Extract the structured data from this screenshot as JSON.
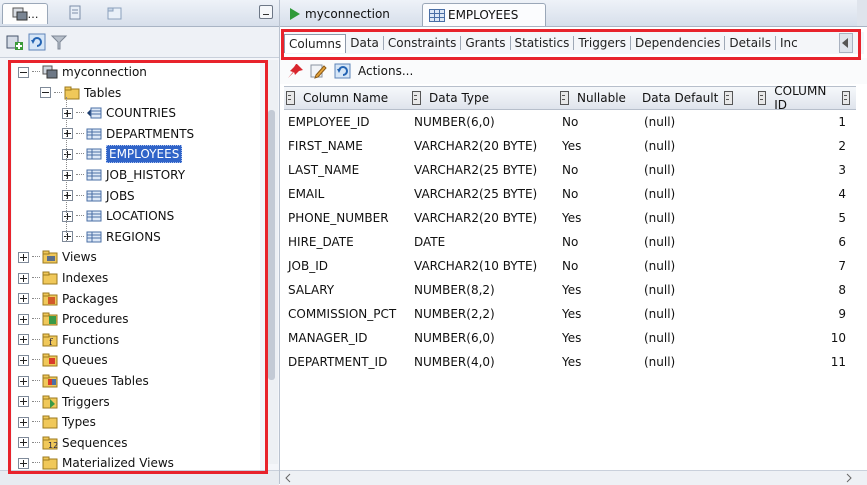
{
  "left_panel": {
    "tab_label": "…",
    "connection": "myconnection",
    "tables_label": "Tables",
    "tables": [
      "COUNTRIES",
      "DEPARTMENTS",
      "EMPLOYEES",
      "JOB_HISTORY",
      "JOBS",
      "LOCATIONS",
      "REGIONS"
    ],
    "selected_table": "EMPLOYEES",
    "folders": [
      "Views",
      "Indexes",
      "Packages",
      "Procedures",
      "Functions",
      "Queues",
      "Queues Tables",
      "Triggers",
      "Types",
      "Sequences",
      "Materialized Views"
    ]
  },
  "doc_tabs": [
    "myconnection",
    "EMPLOYEES"
  ],
  "subtabs": [
    "Columns",
    "Data",
    "Constraints",
    "Grants",
    "Statistics",
    "Triggers",
    "Dependencies",
    "Details",
    "Inc"
  ],
  "actions_label": "Actions...",
  "table": {
    "headers": [
      "Column Name",
      "Data Type",
      "Nullable",
      "Data Default",
      "COLUMN ID"
    ],
    "rows": [
      [
        "EMPLOYEE_ID",
        "NUMBER(6,0)",
        "No",
        "(null)",
        "1"
      ],
      [
        "FIRST_NAME",
        "VARCHAR2(20 BYTE)",
        "Yes",
        "(null)",
        "2"
      ],
      [
        "LAST_NAME",
        "VARCHAR2(25 BYTE)",
        "No",
        "(null)",
        "3"
      ],
      [
        "EMAIL",
        "VARCHAR2(25 BYTE)",
        "No",
        "(null)",
        "4"
      ],
      [
        "PHONE_NUMBER",
        "VARCHAR2(20 BYTE)",
        "Yes",
        "(null)",
        "5"
      ],
      [
        "HIRE_DATE",
        "DATE",
        "No",
        "(null)",
        "6"
      ],
      [
        "JOB_ID",
        "VARCHAR2(10 BYTE)",
        "No",
        "(null)",
        "7"
      ],
      [
        "SALARY",
        "NUMBER(8,2)",
        "Yes",
        "(null)",
        "8"
      ],
      [
        "COMMISSION_PCT",
        "NUMBER(2,2)",
        "Yes",
        "(null)",
        "9"
      ],
      [
        "MANAGER_ID",
        "NUMBER(6,0)",
        "Yes",
        "(null)",
        "10"
      ],
      [
        "DEPARTMENT_ID",
        "NUMBER(4,0)",
        "Yes",
        "(null)",
        "11"
      ]
    ]
  },
  "colors": {
    "highlight": "#e8232c",
    "selection": "#2f63c8",
    "accent": "#2f9a39"
  }
}
